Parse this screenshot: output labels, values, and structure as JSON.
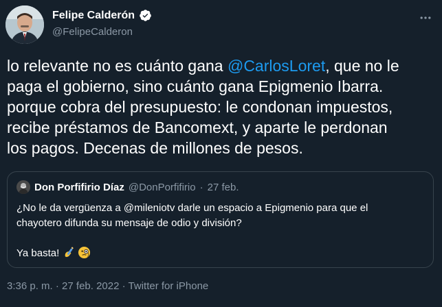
{
  "tweet": {
    "author": {
      "display_name": "Felipe Calderón",
      "handle": "@FelipeCalderon"
    },
    "lines": [
      {
        "before": "lo relevante no es cuánto gana ",
        "mention": "@CarlosLoret",
        "after": ", que no le"
      },
      {
        "text": "paga el gobierno, sino cuánto gana Epigmenio Ibarra."
      },
      {
        "text": "porque cobra del presupuesto: le condonan impuestos,"
      },
      {
        "text": "recibe préstamos de Bancomext, y aparte le perdonan"
      },
      {
        "text": "los pagos. Decenas de millones de pesos."
      }
    ],
    "quoted": {
      "display_name": "Don Porfifirio Díaz",
      "handle": "@DonPorfifirio",
      "separator": "·",
      "date": "27 feb.",
      "lines": [
        "¿No le da vergüenza a @mileniotv darle un espacio a Epigmenio para que el",
        "chayotero difunda su mensaje de odio y división?",
        "",
        "Ya basta!"
      ]
    },
    "meta": {
      "time": "3:36 p. m.",
      "sep1": " · ",
      "date": "27 feb. 2022",
      "sep2": " · ",
      "source": "Twitter for iPhone"
    }
  },
  "colors": {
    "background": "#15202b",
    "text": "#ffffff",
    "secondary": "#8b98a5",
    "accent": "#1d9bf0",
    "border": "#38444d"
  },
  "icons": {
    "verified": "verified-badge-icon",
    "more": "more-options-icon",
    "emojis": [
      "writing-hand-emoji",
      "monocle-face-emoji"
    ]
  }
}
